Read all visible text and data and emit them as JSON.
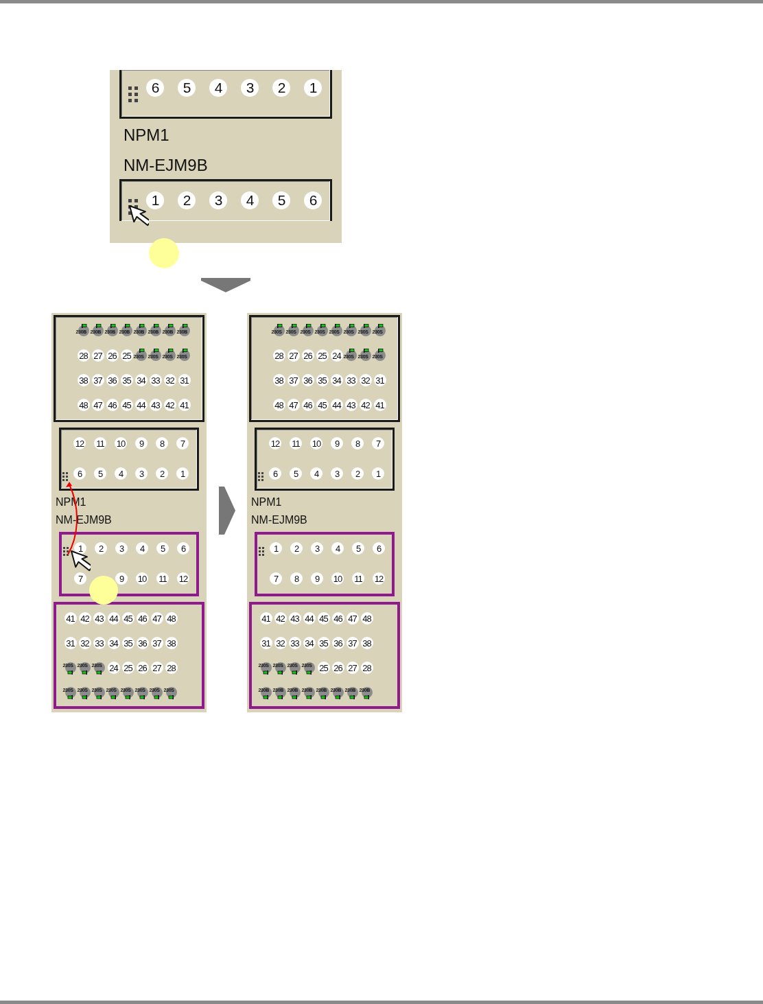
{
  "top_view": {
    "units": [
      {
        "kind": "upper_unit",
        "highlighted": false,
        "cut_top": true,
        "rows": [
          {
            "grip": true,
            "items": [
              {
                "kind": "port",
                "label": "6"
              },
              {
                "kind": "port",
                "label": "5"
              },
              {
                "kind": "port",
                "label": "4"
              },
              {
                "kind": "port",
                "label": "3"
              },
              {
                "kind": "port",
                "label": "2"
              },
              {
                "kind": "port",
                "label": "1"
              }
            ]
          }
        ]
      },
      {
        "kind": "label",
        "text": "NPM1"
      },
      {
        "kind": "label",
        "text": "NM-EJM9B"
      },
      {
        "kind": "lower_unit",
        "highlighted": false,
        "cut_bottom": true,
        "rows": [
          {
            "grip": true,
            "items": [
              {
                "kind": "port",
                "label": "1"
              },
              {
                "kind": "port",
                "label": "2"
              },
              {
                "kind": "port",
                "label": "3"
              },
              {
                "kind": "port",
                "label": "4"
              },
              {
                "kind": "port",
                "label": "5"
              },
              {
                "kind": "port",
                "label": "6"
              }
            ]
          }
        ]
      }
    ]
  },
  "before": {
    "units": [
      {
        "kind": "upper_unit",
        "highlighted": false,
        "rows": [
          {
            "grip": false,
            "items": [
              {
                "kind": "device",
                "label": "230B"
              },
              {
                "kind": "device",
                "label": "230B"
              },
              {
                "kind": "device",
                "label": "230B"
              },
              {
                "kind": "device",
                "label": "230B"
              },
              {
                "kind": "device",
                "label": "230B"
              },
              {
                "kind": "device",
                "label": "230B"
              },
              {
                "kind": "device",
                "label": "230B"
              },
              {
                "kind": "device",
                "label": "230B"
              }
            ]
          },
          {
            "grip": false,
            "items": [
              {
                "kind": "port",
                "label": "28"
              },
              {
                "kind": "port",
                "label": "27"
              },
              {
                "kind": "port",
                "label": "26"
              },
              {
                "kind": "port",
                "label": "25"
              },
              {
                "kind": "device",
                "label": "230S"
              },
              {
                "kind": "device",
                "label": "230S"
              },
              {
                "kind": "device",
                "label": "230S"
              },
              {
                "kind": "device",
                "label": "230S"
              }
            ]
          },
          {
            "grip": false,
            "items": [
              {
                "kind": "port",
                "label": "38"
              },
              {
                "kind": "port",
                "label": "37"
              },
              {
                "kind": "port",
                "label": "36"
              },
              {
                "kind": "port",
                "label": "35"
              },
              {
                "kind": "port",
                "label": "34"
              },
              {
                "kind": "port",
                "label": "33"
              },
              {
                "kind": "port",
                "label": "32"
              },
              {
                "kind": "port",
                "label": "31"
              }
            ]
          },
          {
            "grip": false,
            "items": [
              {
                "kind": "port",
                "label": "48"
              },
              {
                "kind": "port",
                "label": "47"
              },
              {
                "kind": "port",
                "label": "46"
              },
              {
                "kind": "port",
                "label": "45"
              },
              {
                "kind": "port",
                "label": "44"
              },
              {
                "kind": "port",
                "label": "43"
              },
              {
                "kind": "port",
                "label": "42"
              },
              {
                "kind": "port",
                "label": "41"
              }
            ]
          }
        ]
      },
      {
        "kind": "upper_unit",
        "highlighted": false,
        "rows": [
          {
            "grip": false,
            "items": [
              {
                "kind": "port",
                "label": "12"
              },
              {
                "kind": "port",
                "label": "11"
              },
              {
                "kind": "port",
                "label": "10"
              },
              {
                "kind": "port",
                "label": "9"
              },
              {
                "kind": "port",
                "label": "8"
              },
              {
                "kind": "port",
                "label": "7"
              }
            ]
          },
          {
            "grip": true,
            "items": [
              {
                "kind": "port",
                "label": "6"
              },
              {
                "kind": "port",
                "label": "5"
              },
              {
                "kind": "port",
                "label": "4"
              },
              {
                "kind": "port",
                "label": "3"
              },
              {
                "kind": "port",
                "label": "2"
              },
              {
                "kind": "port",
                "label": "1"
              }
            ]
          }
        ]
      },
      {
        "kind": "label",
        "text": "NPM1"
      },
      {
        "kind": "label",
        "text": "NM-EJM9B"
      },
      {
        "kind": "lower_unit",
        "highlighted": true,
        "rows": [
          {
            "grip": true,
            "items": [
              {
                "kind": "port",
                "label": "1"
              },
              {
                "kind": "port",
                "label": "2"
              },
              {
                "kind": "port",
                "label": "3"
              },
              {
                "kind": "port",
                "label": "4"
              },
              {
                "kind": "port",
                "label": "5"
              },
              {
                "kind": "port",
                "label": "6"
              }
            ]
          },
          {
            "grip": false,
            "items": [
              {
                "kind": "port",
                "label": "7"
              },
              {
                "kind": "empty"
              },
              {
                "kind": "port",
                "label": "9"
              },
              {
                "kind": "port",
                "label": "10"
              },
              {
                "kind": "port",
                "label": "11"
              },
              {
                "kind": "port",
                "label": "12"
              }
            ]
          }
        ]
      },
      {
        "kind": "lower_unit",
        "highlighted": true,
        "rows": [
          {
            "grip": false,
            "items": [
              {
                "kind": "port",
                "label": "41"
              },
              {
                "kind": "port",
                "label": "42"
              },
              {
                "kind": "port",
                "label": "43"
              },
              {
                "kind": "port",
                "label": "44"
              },
              {
                "kind": "port",
                "label": "45"
              },
              {
                "kind": "port",
                "label": "46"
              },
              {
                "kind": "port",
                "label": "47"
              },
              {
                "kind": "port",
                "label": "48"
              }
            ]
          },
          {
            "grip": false,
            "items": [
              {
                "kind": "port",
                "label": "31"
              },
              {
                "kind": "port",
                "label": "32"
              },
              {
                "kind": "port",
                "label": "33"
              },
              {
                "kind": "port",
                "label": "34"
              },
              {
                "kind": "port",
                "label": "35"
              },
              {
                "kind": "port",
                "label": "36"
              },
              {
                "kind": "port",
                "label": "37"
              },
              {
                "kind": "port",
                "label": "38"
              }
            ]
          },
          {
            "grip": false,
            "items": [
              {
                "kind": "device",
                "label": "230S"
              },
              {
                "kind": "device",
                "label": "230S"
              },
              {
                "kind": "device",
                "label": "230S"
              },
              {
                "kind": "port",
                "label": "24"
              },
              {
                "kind": "port",
                "label": "25"
              },
              {
                "kind": "port",
                "label": "26"
              },
              {
                "kind": "port",
                "label": "27"
              },
              {
                "kind": "port",
                "label": "28"
              }
            ]
          },
          {
            "grip": false,
            "items": [
              {
                "kind": "device",
                "label": "230S"
              },
              {
                "kind": "device",
                "label": "230S"
              },
              {
                "kind": "device",
                "label": "230S"
              },
              {
                "kind": "device",
                "label": "230S"
              },
              {
                "kind": "device",
                "label": "230S"
              },
              {
                "kind": "device",
                "label": "230S"
              },
              {
                "kind": "device",
                "label": "230S"
              },
              {
                "kind": "device",
                "label": "230S"
              }
            ]
          }
        ]
      }
    ]
  },
  "after": {
    "units": [
      {
        "kind": "upper_unit",
        "highlighted": false,
        "rows": [
          {
            "grip": false,
            "items": [
              {
                "kind": "device",
                "label": "230S"
              },
              {
                "kind": "device",
                "label": "230S"
              },
              {
                "kind": "device",
                "label": "230S"
              },
              {
                "kind": "device",
                "label": "230S"
              },
              {
                "kind": "device",
                "label": "230S"
              },
              {
                "kind": "device",
                "label": "230S"
              },
              {
                "kind": "device",
                "label": "230S"
              },
              {
                "kind": "device",
                "label": "230S"
              }
            ]
          },
          {
            "grip": false,
            "items": [
              {
                "kind": "port",
                "label": "28"
              },
              {
                "kind": "port",
                "label": "27"
              },
              {
                "kind": "port",
                "label": "26"
              },
              {
                "kind": "port",
                "label": "25"
              },
              {
                "kind": "port",
                "label": "24"
              },
              {
                "kind": "device",
                "label": "230S"
              },
              {
                "kind": "device",
                "label": "230S"
              },
              {
                "kind": "device",
                "label": "230S"
              }
            ]
          },
          {
            "grip": false,
            "items": [
              {
                "kind": "port",
                "label": "38"
              },
              {
                "kind": "port",
                "label": "37"
              },
              {
                "kind": "port",
                "label": "36"
              },
              {
                "kind": "port",
                "label": "35"
              },
              {
                "kind": "port",
                "label": "34"
              },
              {
                "kind": "port",
                "label": "33"
              },
              {
                "kind": "port",
                "label": "32"
              },
              {
                "kind": "port",
                "label": "31"
              }
            ]
          },
          {
            "grip": false,
            "items": [
              {
                "kind": "port",
                "label": "48"
              },
              {
                "kind": "port",
                "label": "47"
              },
              {
                "kind": "port",
                "label": "46"
              },
              {
                "kind": "port",
                "label": "45"
              },
              {
                "kind": "port",
                "label": "44"
              },
              {
                "kind": "port",
                "label": "43"
              },
              {
                "kind": "port",
                "label": "42"
              },
              {
                "kind": "port",
                "label": "41"
              }
            ]
          }
        ]
      },
      {
        "kind": "upper_unit",
        "highlighted": false,
        "rows": [
          {
            "grip": false,
            "items": [
              {
                "kind": "port",
                "label": "12"
              },
              {
                "kind": "port",
                "label": "11"
              },
              {
                "kind": "port",
                "label": "10"
              },
              {
                "kind": "port",
                "label": "9"
              },
              {
                "kind": "port",
                "label": "8"
              },
              {
                "kind": "port",
                "label": "7"
              }
            ]
          },
          {
            "grip": true,
            "items": [
              {
                "kind": "port",
                "label": "6"
              },
              {
                "kind": "port",
                "label": "5"
              },
              {
                "kind": "port",
                "label": "4"
              },
              {
                "kind": "port",
                "label": "3"
              },
              {
                "kind": "port",
                "label": "2"
              },
              {
                "kind": "port",
                "label": "1"
              }
            ]
          }
        ]
      },
      {
        "kind": "label",
        "text": "NPM1"
      },
      {
        "kind": "label",
        "text": "NM-EJM9B"
      },
      {
        "kind": "lower_unit",
        "highlighted": true,
        "rows": [
          {
            "grip": true,
            "items": [
              {
                "kind": "port",
                "label": "1"
              },
              {
                "kind": "port",
                "label": "2"
              },
              {
                "kind": "port",
                "label": "3"
              },
              {
                "kind": "port",
                "label": "4"
              },
              {
                "kind": "port",
                "label": "5"
              },
              {
                "kind": "port",
                "label": "6"
              }
            ]
          },
          {
            "grip": false,
            "items": [
              {
                "kind": "port",
                "label": "7"
              },
              {
                "kind": "port",
                "label": "8"
              },
              {
                "kind": "port",
                "label": "9"
              },
              {
                "kind": "port",
                "label": "10"
              },
              {
                "kind": "port",
                "label": "11"
              },
              {
                "kind": "port",
                "label": "12"
              }
            ]
          }
        ]
      },
      {
        "kind": "lower_unit",
        "highlighted": true,
        "rows": [
          {
            "grip": false,
            "items": [
              {
                "kind": "port",
                "label": "41"
              },
              {
                "kind": "port",
                "label": "42"
              },
              {
                "kind": "port",
                "label": "43"
              },
              {
                "kind": "port",
                "label": "44"
              },
              {
                "kind": "port",
                "label": "45"
              },
              {
                "kind": "port",
                "label": "46"
              },
              {
                "kind": "port",
                "label": "47"
              },
              {
                "kind": "port",
                "label": "48"
              }
            ]
          },
          {
            "grip": false,
            "items": [
              {
                "kind": "port",
                "label": "31"
              },
              {
                "kind": "port",
                "label": "32"
              },
              {
                "kind": "port",
                "label": "33"
              },
              {
                "kind": "port",
                "label": "34"
              },
              {
                "kind": "port",
                "label": "35"
              },
              {
                "kind": "port",
                "label": "36"
              },
              {
                "kind": "port",
                "label": "37"
              },
              {
                "kind": "port",
                "label": "38"
              }
            ]
          },
          {
            "grip": false,
            "items": [
              {
                "kind": "device",
                "label": "230S"
              },
              {
                "kind": "device",
                "label": "230S"
              },
              {
                "kind": "device",
                "label": "230S"
              },
              {
                "kind": "device",
                "label": "230S"
              },
              {
                "kind": "port",
                "label": "25"
              },
              {
                "kind": "port",
                "label": "26"
              },
              {
                "kind": "port",
                "label": "27"
              },
              {
                "kind": "port",
                "label": "28"
              }
            ]
          },
          {
            "grip": false,
            "items": [
              {
                "kind": "device",
                "label": "230B"
              },
              {
                "kind": "device",
                "label": "230B"
              },
              {
                "kind": "device",
                "label": "230B"
              },
              {
                "kind": "device",
                "label": "230B"
              },
              {
                "kind": "device",
                "label": "230B"
              },
              {
                "kind": "device",
                "label": "230B"
              },
              {
                "kind": "device",
                "label": "230B"
              },
              {
                "kind": "device",
                "label": "230B"
              }
            ]
          }
        ]
      }
    ]
  }
}
